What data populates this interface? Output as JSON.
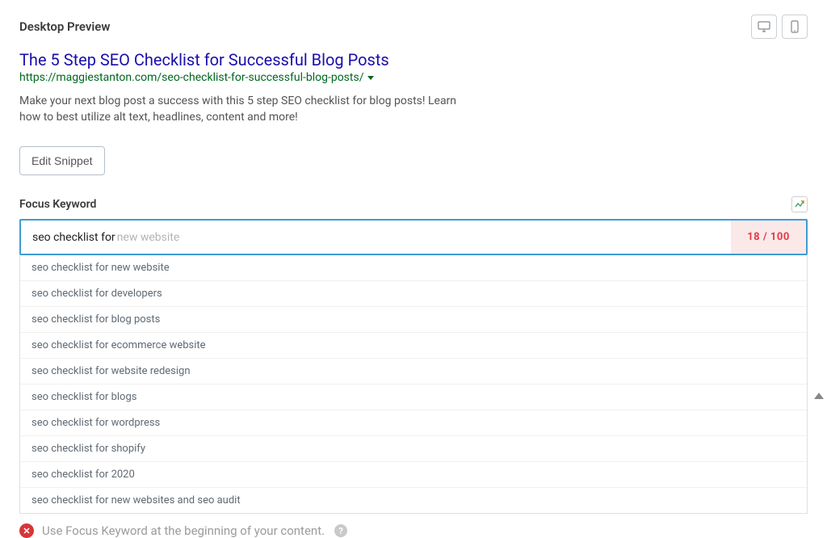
{
  "header": {
    "title": "Desktop Preview"
  },
  "serp": {
    "title": "The 5 Step SEO Checklist for Successful Blog Posts",
    "url": "https://maggiestanton.com/seo-checklist-for-successful-blog-posts/",
    "description": "Make your next blog post a success with this 5 step SEO checklist for blog posts! Learn how to best utilize alt text, headlines, content and more!"
  },
  "buttons": {
    "edit_snippet": "Edit Snippet"
  },
  "keyword": {
    "label": "Focus Keyword",
    "typed": "seo checklist for",
    "ghost": "new website",
    "count": "18 / 100",
    "suggestions": [
      "seo checklist for new website",
      "seo checklist for developers",
      "seo checklist for blog posts",
      "seo checklist for ecommerce website",
      "seo checklist for website redesign",
      "seo checklist for blogs",
      "seo checklist for wordpress",
      "seo checklist for shopify",
      "seo checklist for 2020",
      "seo checklist for new websites and seo audit"
    ]
  },
  "footer": {
    "tip": "Use Focus Keyword at the beginning of your content."
  }
}
